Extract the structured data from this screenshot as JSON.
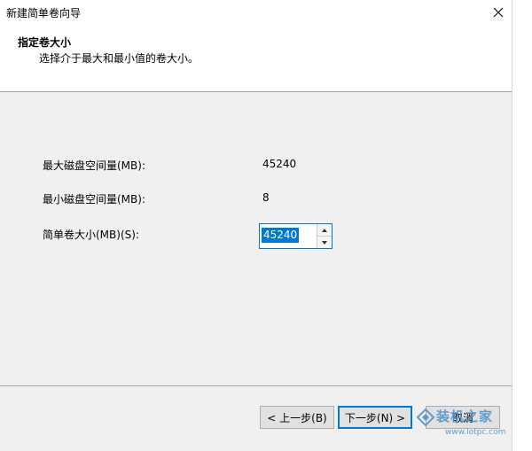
{
  "window": {
    "title": "新建简单卷向导"
  },
  "header": {
    "title": "指定卷大小",
    "subtitle": "选择介于最大和最小值的卷大小。"
  },
  "fields": {
    "max_label": "最大磁盘空间量(MB):",
    "max_value": "45240",
    "min_label": "最小磁盘空间量(MB):",
    "min_value": "8",
    "size_label": "简单卷大小(MB)(S):",
    "size_value": "45240"
  },
  "buttons": {
    "back": "< 上一步(B)",
    "next": "下一步(N) >",
    "cancel": "取消"
  },
  "watermark": {
    "text": "装机之家",
    "url": "www.lotpc.com"
  },
  "colors": {
    "accent": "#0078d7",
    "watermark": "#4a90c8"
  },
  "icons": {
    "close": "close-icon",
    "spin_up": "arrow-up-icon",
    "spin_down": "arrow-down-icon"
  }
}
